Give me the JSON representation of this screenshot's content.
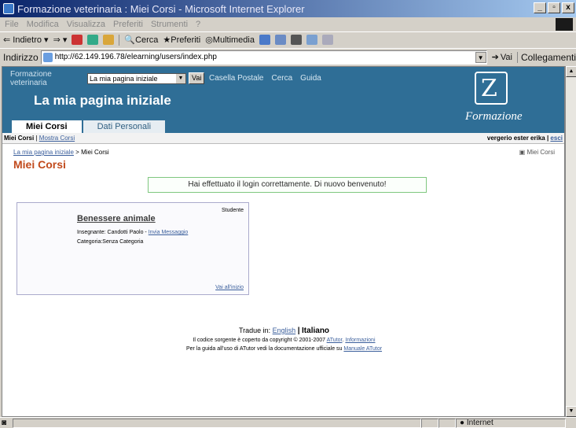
{
  "window": {
    "title": "Formazione veterinaria : Miei Corsi - Microsoft Internet Explorer",
    "min": "_",
    "max": "▫",
    "close": "x"
  },
  "menu": [
    "File",
    "Modifica",
    "Visualizza",
    "Preferiti",
    "Strumenti",
    "?"
  ],
  "toolbar": {
    "back": "Indietro",
    "search": "Cerca",
    "favorites": "Preferiti",
    "media": "Multimedia"
  },
  "address": {
    "label": "Indirizzo",
    "url": "http://62.149.196.78/elearning/users/index.php",
    "go": "Vai",
    "links": "Collegamenti"
  },
  "site": {
    "name_line1": "Formazione",
    "name_line2": "veterinaria",
    "select_value": "La mia pagina iniziale",
    "go_button": "Vai",
    "top_links": [
      "Casella Postale",
      "Cerca",
      "Guida"
    ],
    "heading": "La mia pagina iniziale",
    "logo_text": "Formazione",
    "tabs": [
      "Miei Corsi",
      "Dati Personali"
    ]
  },
  "subbar": {
    "current": "Miei Corsi",
    "separator": "|",
    "link": "Mostra Corsi",
    "user": "vergerio ester erika",
    "logout": "esci"
  },
  "content": {
    "breadcrumb_link": "La mia pagina iniziale",
    "breadcrumb_sep": ">",
    "breadcrumb_current": "Miei Corsi",
    "myinfo": "Miei Corsi",
    "section_title": "Miei Corsi",
    "feedback": "Hai effettuato il login correttamente. Di nuovo benvenuto!",
    "course": {
      "role": "Studente",
      "title": "Benessere animale",
      "teacher_label": "Insegnante:",
      "teacher": "Candotti Paolo",
      "teacher_sep": "-",
      "send_message": "Invia Messaggio",
      "category_label": "Categoria:",
      "category": "Senza Categoria",
      "goto": "Vai all'inizio"
    }
  },
  "footer": {
    "translate_label": "Tradue in:",
    "lang_link": "English",
    "lang_sep": "|",
    "lang_current": "Italiano",
    "copyright": "Il codice sorgente è coperto da copyright © 2001-2007",
    "atutor": "ATutor",
    "info_link": "Informazioni",
    "guide_text": "Per la guida all'uso di ATutor vedi la documentazione ufficiale su",
    "manual_link": "Manuale ATutor"
  },
  "status": {
    "zone": "Internet"
  }
}
